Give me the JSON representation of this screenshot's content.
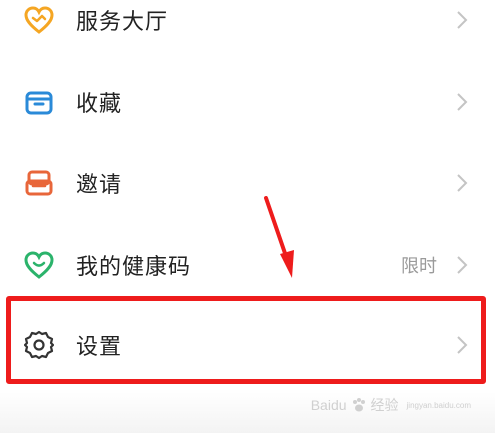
{
  "menu": {
    "items": [
      {
        "label": "服务大厅",
        "icon": "heart-service-icon",
        "badge": ""
      },
      {
        "label": "收藏",
        "icon": "folder-icon",
        "badge": ""
      },
      {
        "label": "邀请",
        "icon": "invite-icon",
        "badge": ""
      },
      {
        "label": "我的健康码",
        "icon": "health-heart-icon",
        "badge": "限时"
      },
      {
        "label": "设置",
        "icon": "gear-icon",
        "badge": ""
      }
    ]
  },
  "annotation": {
    "highlighted_item": "设置"
  },
  "watermark": {
    "brand": "Baidu",
    "suffix": "经验",
    "domain": "jingyan.baidu.com"
  },
  "colors": {
    "service": "#f5a623",
    "favorites": "#2a8ad8",
    "invite": "#e8663a",
    "health": "#2bb36b",
    "gear": "#333333",
    "highlight": "#ee1c1c",
    "chevron": "#c4c4c4"
  }
}
